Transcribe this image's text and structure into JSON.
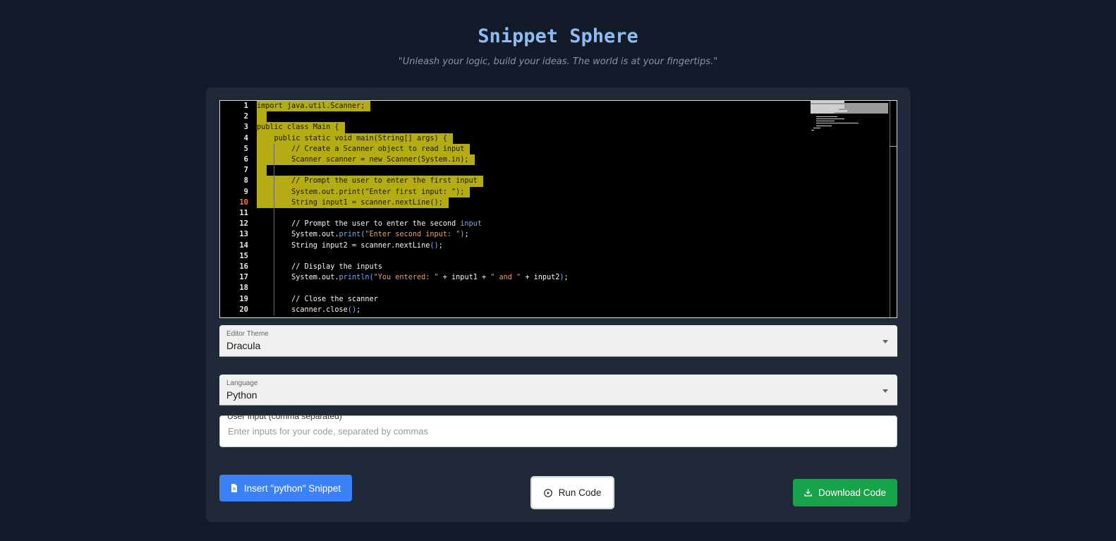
{
  "header": {
    "title": "Snippet Sphere",
    "subtitle": "\"Unleash your logic, build your ideas. The world is at your fingertips.\""
  },
  "editor": {
    "active_line": 10,
    "line_numbers": [
      "1",
      "2",
      "3",
      "4",
      "5",
      "6",
      "7",
      "8",
      "9",
      "10",
      "11",
      "12",
      "13",
      "14",
      "15",
      "16",
      "17",
      "18",
      "19",
      "20"
    ],
    "lines": [
      "import java.util.Scanner;",
      "",
      "public class Main {",
      "    public static void main(String[] args) {",
      "        // Create a Scanner object to read input",
      "        Scanner scanner = new Scanner(System.in);",
      "",
      "        // Prompt the user to enter the first input",
      "        System.out.print(\"Enter first input: \");",
      "        String input1 = scanner.nextLine();",
      "",
      "        // Prompt the user to enter the second input",
      "        System.out.print(\"Enter second input: \");",
      "        String input2 = scanner.nextLine();",
      "",
      "        // Display the inputs",
      "        System.out.println(\"You entered: \" + input1 + \" and \" + input2);",
      "",
      "        // Close the scanner",
      "        scanner.close();"
    ]
  },
  "theme_select": {
    "label": "Editor Theme",
    "value": "Dracula"
  },
  "language_select": {
    "label": "Language",
    "value": "Python"
  },
  "user_input": {
    "label": "User Input (comma separated)",
    "placeholder": "Enter inputs for your code, separated by commas",
    "value": ""
  },
  "buttons": {
    "insert_label": "Insert \"python\" Snippet",
    "run_label": "Run Code",
    "download_label": "Download Code"
  },
  "icons": {
    "insert": "file-code-icon",
    "run": "play-circle-icon",
    "download": "download-icon"
  },
  "colors": {
    "background": "#131a29",
    "card": "#1f2937",
    "title": "#8cbcf2",
    "selection": "#b5ab13",
    "insert_button": "#3b82f6",
    "download_button": "#16a34a"
  }
}
